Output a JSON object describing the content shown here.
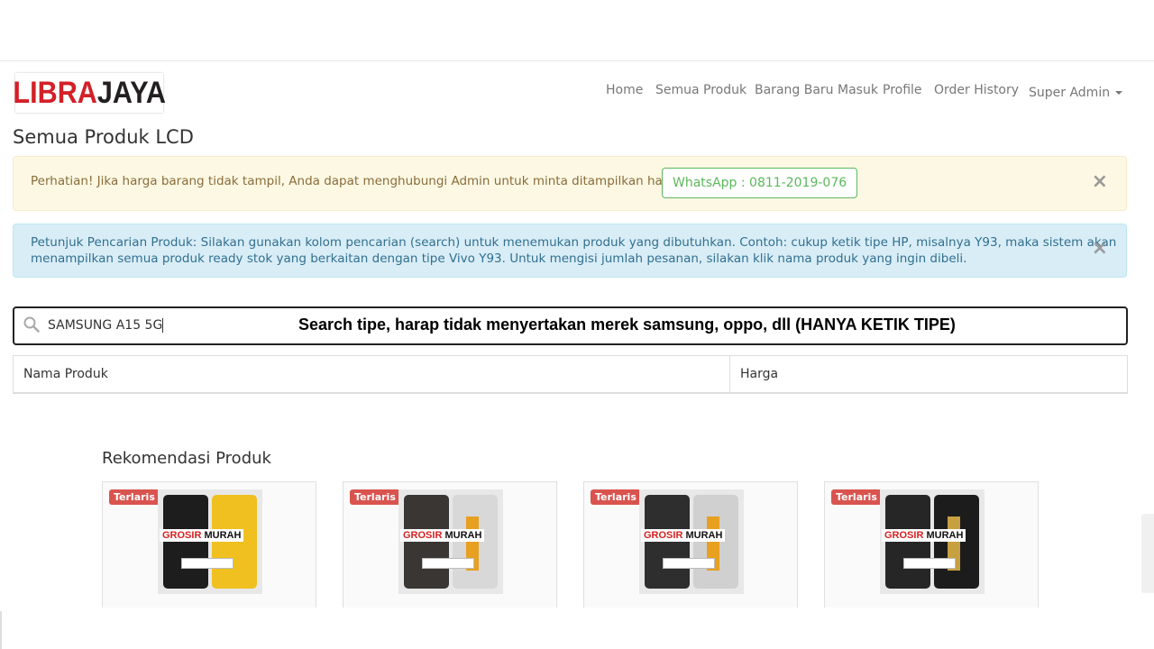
{
  "brand": {
    "logo_part1": "LIBRA",
    "logo_part2": "JAYA",
    "color_red": "#d32027",
    "color_dark": "#231f20"
  },
  "nav": {
    "items": [
      "Home",
      "Semua Produk",
      "Barang Baru Masuk",
      "Profile",
      "Order History"
    ],
    "user_menu": "Super Admin"
  },
  "page": {
    "title": "Semua Produk LCD"
  },
  "alerts": {
    "warning": {
      "text": "Perhatian! Jika harga barang tidak tampil, Anda dapat menghubungi Admin untuk minta ditampilkan harga.",
      "button": "WhatsApp : 0811-2019-076",
      "close": "×"
    },
    "info": {
      "line1": "Petunjuk Pencarian Produk: Silakan gunakan kolom pencarian (search) untuk menemukan produk yang dibutuhkan. Contoh: cukup ketik tipe HP, misalnya Y93, maka sistem akan",
      "line2": "menampilkan semua produk ready stok yang berkaitan dengan tipe Vivo Y93. Untuk mengisi jumlah pesanan, silakan klik nama produk yang ingin dibeli.",
      "close": "×"
    }
  },
  "search": {
    "value": "SAMSUNG A15 5G",
    "hint": "Search tipe, harap tidak menyertakan merek samsung, oppo, dll (HANYA KETIK TIPE)",
    "icon": "search-icon"
  },
  "table": {
    "columns": [
      "Nama Produk",
      "Harga"
    ]
  },
  "recommend": {
    "title": "Rekomendasi Produk",
    "cards": [
      {
        "badge": "Terlaris",
        "promo_a": "GROSIR",
        "promo_b": "MURAH"
      },
      {
        "badge": "Terlaris",
        "promo_a": "GROSIR",
        "promo_b": "MURAH"
      },
      {
        "badge": "Terlaris",
        "promo_a": "GROSIR",
        "promo_b": "MURAH"
      },
      {
        "badge": "Terlaris",
        "promo_a": "GROSIR",
        "promo_b": "MURAH"
      }
    ]
  }
}
